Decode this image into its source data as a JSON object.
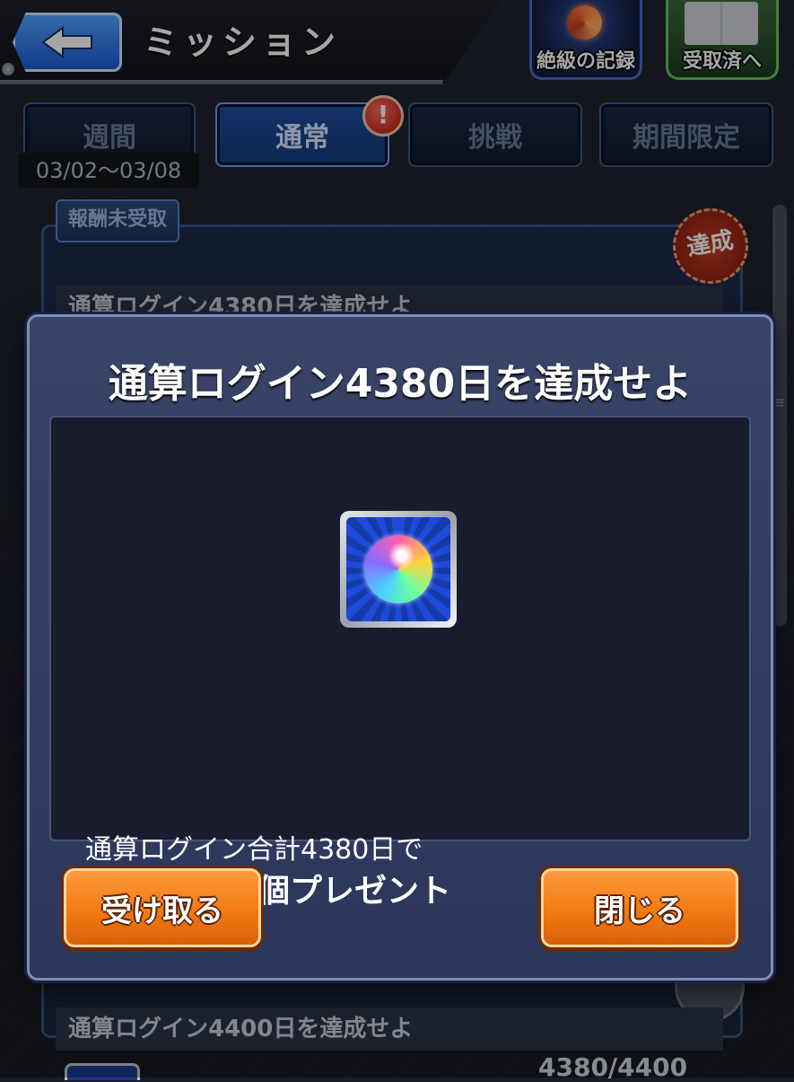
{
  "header": {
    "title": "ミッション",
    "record_label": "絶級の記録",
    "received_label": "受取済へ"
  },
  "tabs": [
    {
      "label": "週間",
      "active": false
    },
    {
      "label": "通常",
      "active": true
    },
    {
      "label": "挑戦",
      "active": false
    },
    {
      "label": "期間限定",
      "active": false
    }
  ],
  "weekly_date": "03/02〜03/08",
  "alert_badge": "!",
  "list": {
    "reward_tag": "報酬未受取",
    "achieved_stamp": "達成",
    "row1_title": "通算ログイン4380日を達成せよ",
    "row2_title": "通算ログイン4400日を達成せよ",
    "row2_progress": "4380/4400"
  },
  "modal": {
    "title": "通算ログイン4380日を達成せよ",
    "reward_item": "orb-icon",
    "description_line1": "通算ログイン合計4380日で",
    "description_line2": "オーブを50個プレゼント",
    "receive_button": "受け取る",
    "close_button": "閉じる"
  },
  "colors": {
    "accent_orange": "#f27a12",
    "tab_active": "#1f4e9e",
    "modal_bg": "#2c355a"
  }
}
